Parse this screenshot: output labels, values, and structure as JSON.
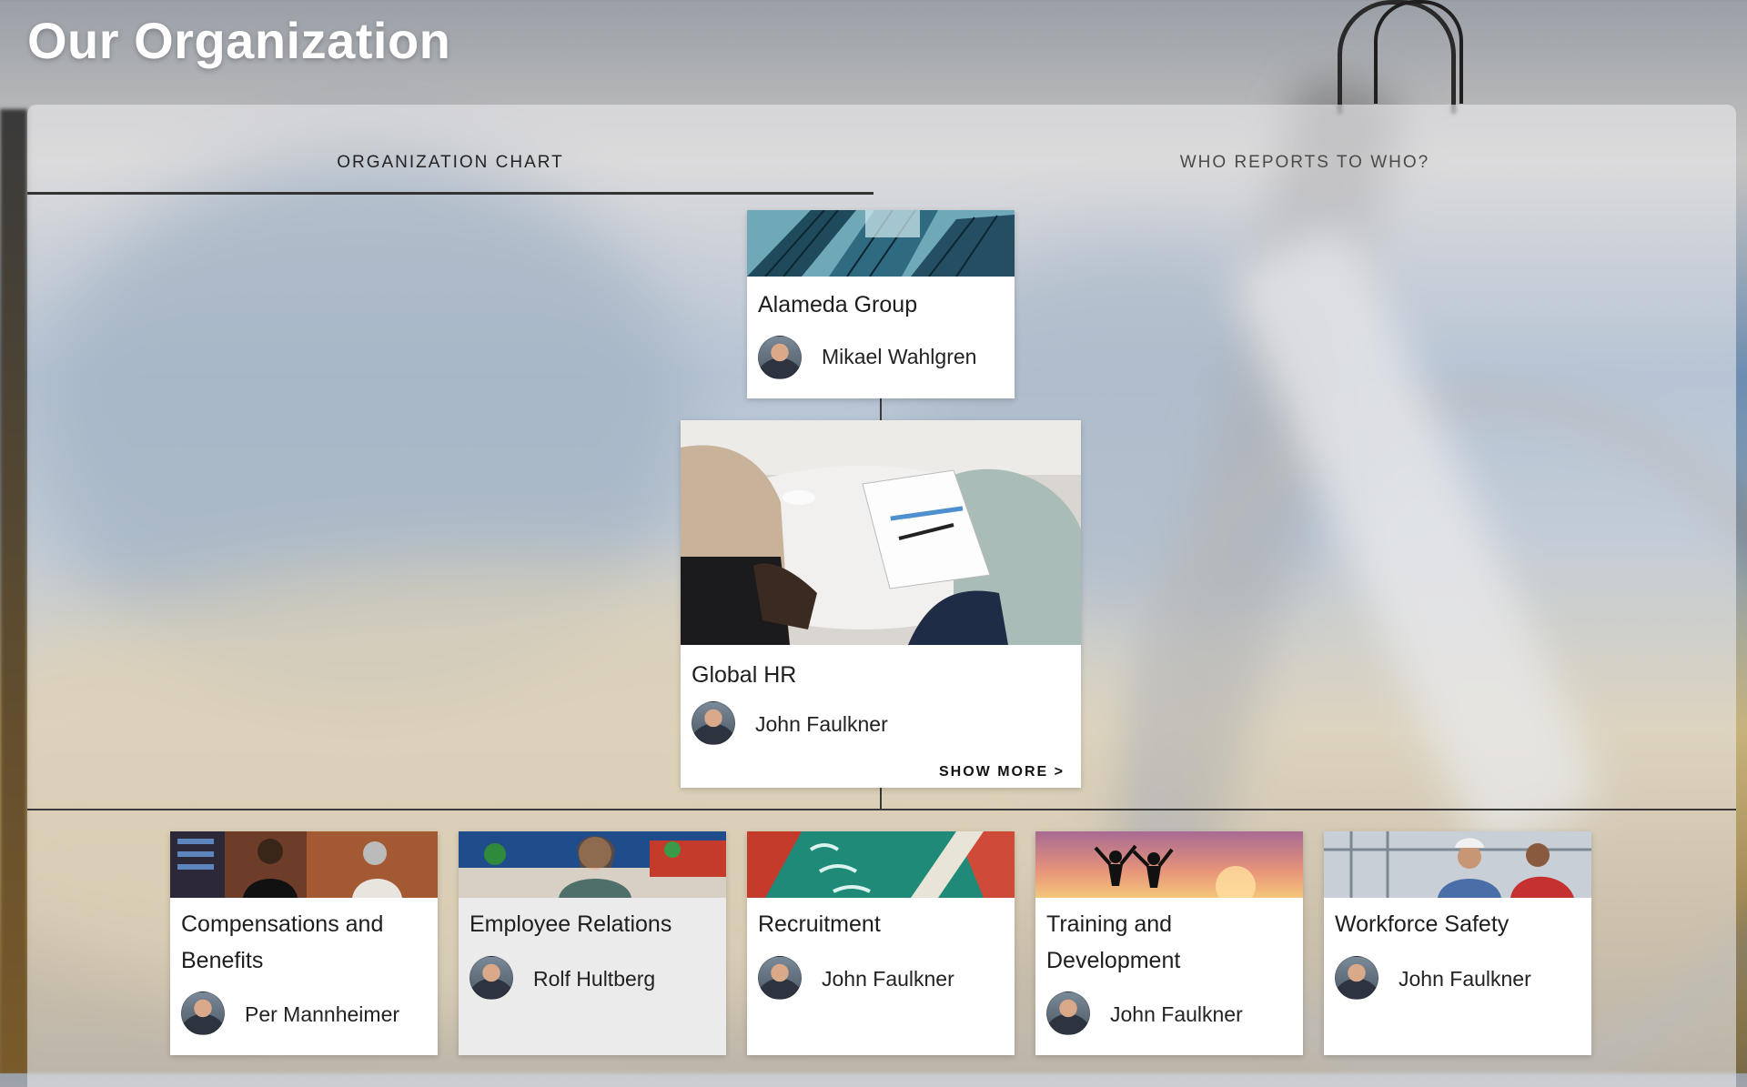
{
  "page": {
    "title": "Our Organization"
  },
  "tabs": [
    {
      "label": "ORGANIZATION CHART",
      "active": true
    },
    {
      "label": "WHO REPORTS TO WHO?",
      "active": false
    }
  ],
  "org": {
    "root": {
      "title": "Alameda Group",
      "person": "Mikael Wahlgren",
      "image": "glass-building-photo"
    },
    "hr": {
      "title": "Global HR",
      "person": "John Faulkner",
      "image": "meeting-clipboard-photo",
      "action": "SHOW MORE >"
    },
    "children": [
      {
        "title": "Compensations and Benefits",
        "person": "Per Mannheimer",
        "image": "office-conversation-photo"
      },
      {
        "title": "Employee Relations",
        "person": "Rolf Hultberg",
        "image": "woman-on-phone-photo"
      },
      {
        "title": "Recruitment",
        "person": "John Faulkner",
        "image": "neon-sign-photo"
      },
      {
        "title": "Training and Development",
        "person": "John Faulkner",
        "image": "sunset-jump-photo"
      },
      {
        "title": "Workforce Safety",
        "person": "John Faulkner",
        "image": "factory-workers-photo"
      }
    ]
  }
}
